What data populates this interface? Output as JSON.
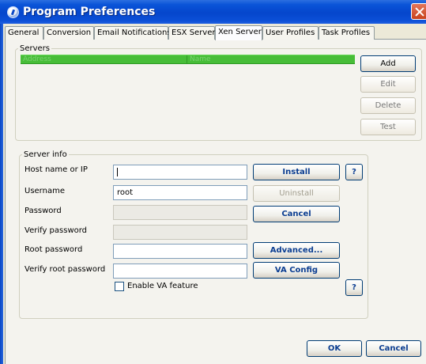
{
  "window": {
    "title": "Program Preferences"
  },
  "tabs": [
    {
      "label": "General"
    },
    {
      "label": "Conversion"
    },
    {
      "label": "Email Notifications"
    },
    {
      "label": "ESX Server"
    },
    {
      "label": "Xen Server"
    },
    {
      "label": "User Profiles"
    },
    {
      "label": "Task Profiles"
    }
  ],
  "active_tab": "Xen Server",
  "servers": {
    "legend": "Servers",
    "columns": [
      "Address",
      "Name"
    ],
    "rows": [],
    "buttons": {
      "add": "Add",
      "edit": "Edit",
      "delete": "Delete",
      "test": "Test"
    }
  },
  "server_info": {
    "legend": "Server info",
    "fields": {
      "host": {
        "label": "Host name or IP",
        "value": ""
      },
      "username": {
        "label": "Username",
        "value": "root"
      },
      "password": {
        "label": "Password",
        "value": ""
      },
      "verify_password": {
        "label": "Verify password",
        "value": ""
      },
      "root_password": {
        "label": "Root password",
        "value": ""
      },
      "verify_root_password": {
        "label": "Verify root password",
        "value": ""
      }
    },
    "buttons": {
      "install": "Install",
      "uninstall": "Uninstall",
      "cancel": "Cancel",
      "advanced": "Advanced...",
      "va_config": "VA Config",
      "help": "?"
    },
    "enable_va": {
      "label": "Enable VA feature",
      "checked": false
    }
  },
  "footer": {
    "ok": "OK",
    "cancel": "Cancel"
  },
  "colors": {
    "title_bar": "#0a54d8",
    "grid_header": "#47bd38",
    "button_text": "#0b3d91"
  }
}
